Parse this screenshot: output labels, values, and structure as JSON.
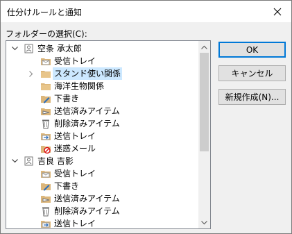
{
  "window": {
    "title": "仕分けルールと通知"
  },
  "dialog": {
    "folder_label": "フォルダーの選択(C):",
    "buttons": {
      "ok": "OK",
      "cancel": "キャンセル",
      "new": "新規作成(N)..."
    }
  },
  "tree": [
    {
      "label": "空条 承太郎",
      "level": 0,
      "icon": "account-icon",
      "expander": "expanded"
    },
    {
      "label": "受信トレイ",
      "level": 1,
      "icon": "inbox-icon",
      "expander": "none"
    },
    {
      "label": "スタンド使い関係",
      "level": 1,
      "icon": "folder-icon",
      "expander": "collapsed",
      "selected": true
    },
    {
      "label": "海洋生物関係",
      "level": 1,
      "icon": "folder-icon",
      "expander": "none"
    },
    {
      "label": "下書き",
      "level": 1,
      "icon": "drafts-icon",
      "expander": "none"
    },
    {
      "label": "送信済みアイテム",
      "level": 1,
      "icon": "sent-items-icon",
      "expander": "none"
    },
    {
      "label": "削除済みアイテム",
      "level": 1,
      "icon": "trash-icon",
      "expander": "none"
    },
    {
      "label": "送信トレイ",
      "level": 1,
      "icon": "outbox-icon",
      "expander": "none"
    },
    {
      "label": "迷惑メール",
      "level": 1,
      "icon": "junk-icon",
      "expander": "none"
    },
    {
      "label": "吉良 吉影",
      "level": 0,
      "icon": "account-icon",
      "expander": "expanded"
    },
    {
      "label": "受信トレイ",
      "level": 1,
      "icon": "inbox-icon",
      "expander": "none"
    },
    {
      "label": "下書き",
      "level": 1,
      "icon": "drafts-icon",
      "expander": "none"
    },
    {
      "label": "送信済みアイテム",
      "level": 1,
      "icon": "sent-items-icon",
      "expander": "none"
    },
    {
      "label": "削除済みアイテム",
      "level": 1,
      "icon": "trash-icon",
      "expander": "none"
    },
    {
      "label": "送信トレイ",
      "level": 1,
      "icon": "outbox-icon",
      "expander": "none"
    }
  ],
  "colors": {
    "selection": "#cce8ff",
    "default_button_border": "#0078d7",
    "folder": "#dcb67a"
  }
}
